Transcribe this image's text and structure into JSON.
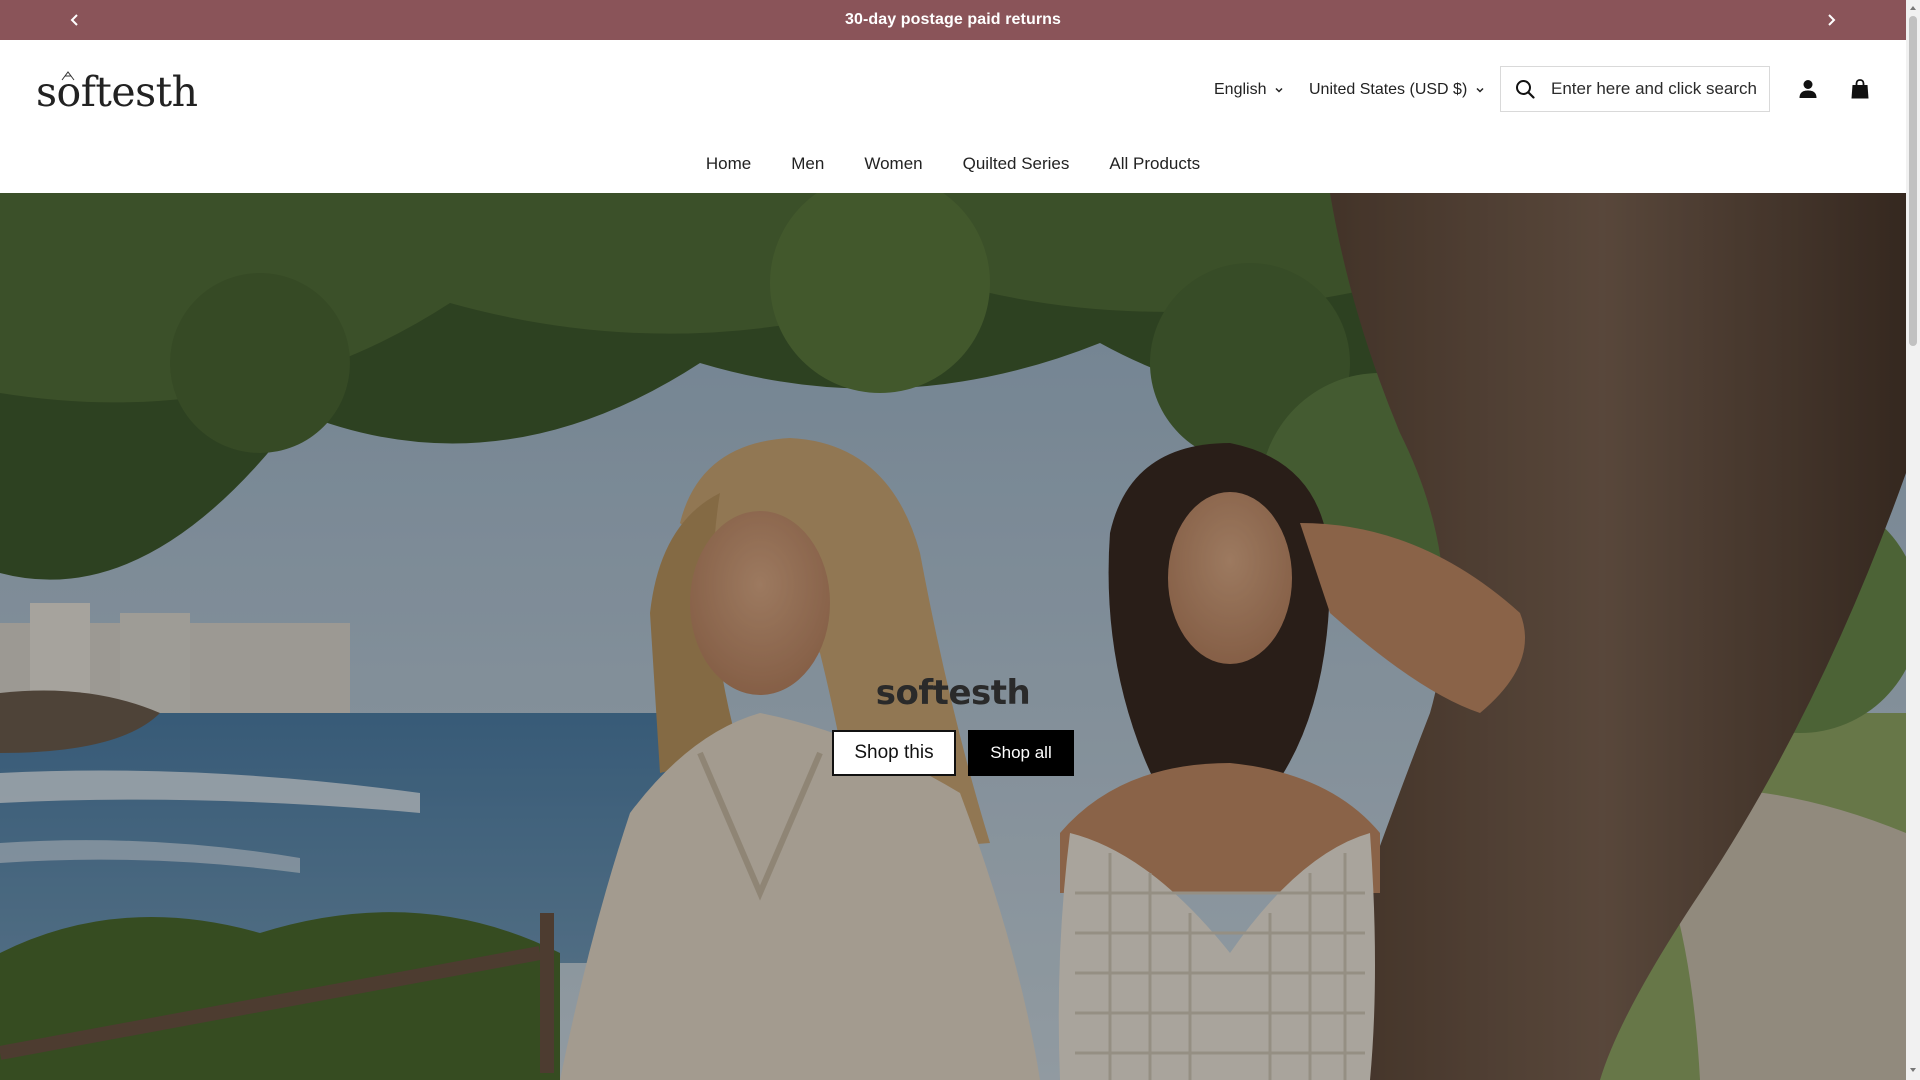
{
  "announcement": {
    "text": "30-day postage paid returns",
    "prev_icon": "chevron-left-icon",
    "next_icon": "chevron-right-icon",
    "background": "#8a5459"
  },
  "header": {
    "logo_text": "softesth",
    "language": "English",
    "country": "United States (USD $)",
    "search": {
      "placeholder": "Enter here and click search",
      "value": ""
    },
    "icons": [
      "search-icon",
      "account-icon",
      "cart-icon"
    ]
  },
  "nav": {
    "items": [
      {
        "label": "Home"
      },
      {
        "label": "Men"
      },
      {
        "label": "Women"
      },
      {
        "label": "Quilted Series"
      },
      {
        "label": "All Products"
      }
    ]
  },
  "hero": {
    "brand": "softesth",
    "buttons": {
      "shop_this": "Shop this",
      "shop_all": "Shop all"
    }
  }
}
